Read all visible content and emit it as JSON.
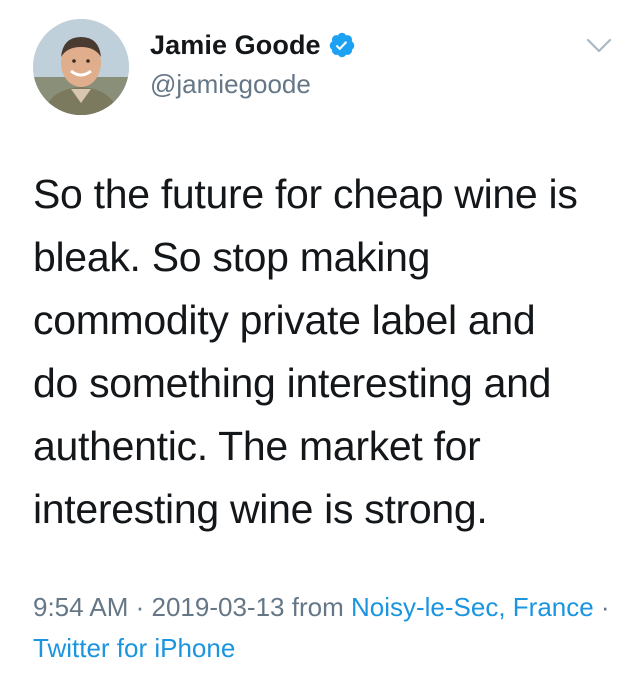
{
  "user": {
    "display_name": "Jamie Goode",
    "handle": "@jamiegoode",
    "verified": true,
    "avatar_icon": "profile-photo"
  },
  "tweet": {
    "text": "So the future for cheap wine is\nbleak. So stop making\ncommodity private label and\ndo something interesting and\nauthentic. The market for\ninteresting wine is strong."
  },
  "meta": {
    "time": "9:54 AM",
    "separator1": " · ",
    "date": "2019-03-13",
    "from_label": " from ",
    "location": "Noisy-le-Sec, France",
    "separator2": " · ",
    "source": "Twitter for iPhone"
  },
  "colors": {
    "text": "#14171a",
    "secondary": "#657786",
    "link": "#1b95e0",
    "verified_badge": "#1da1f2"
  },
  "icons": {
    "verified": "verified-badge-icon",
    "menu": "chevron-down-icon"
  }
}
